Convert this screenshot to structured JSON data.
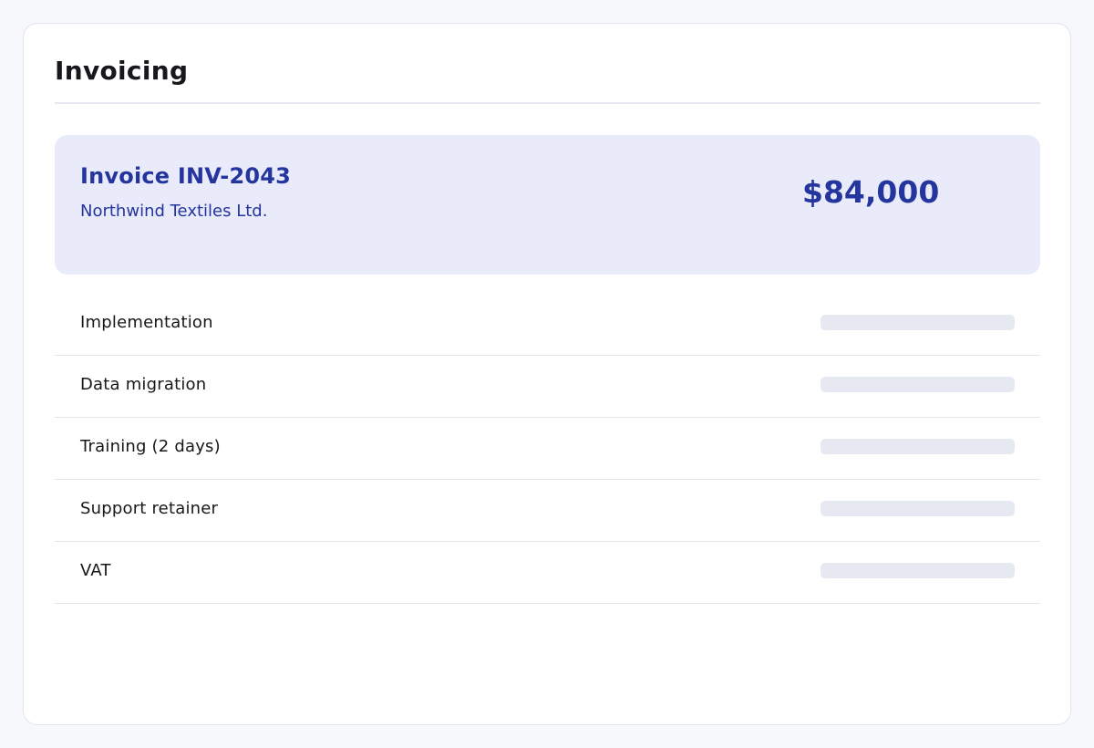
{
  "page": {
    "title": "Invoicing"
  },
  "invoice": {
    "id_label": "Invoice INV-2043",
    "customer": "Northwind Textiles Ltd.",
    "total": "$84,000"
  },
  "line_items": [
    {
      "label": "Implementation"
    },
    {
      "label": "Data migration"
    },
    {
      "label": "Training (2 days)"
    },
    {
      "label": "Support retainer"
    },
    {
      "label": "VAT"
    }
  ],
  "colors": {
    "accent": "#24359e",
    "summary_background": "#e9eafa",
    "placeholder": "#e7e9f2",
    "text": "#17171c"
  }
}
